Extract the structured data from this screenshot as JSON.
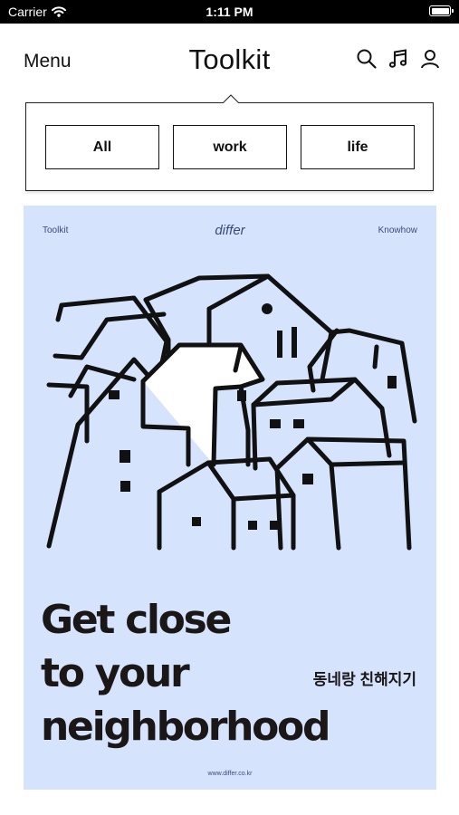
{
  "status_bar": {
    "carrier": "Carrier",
    "time": "1:11 PM"
  },
  "nav": {
    "menu_label": "Menu",
    "title": "Toolkit",
    "icons": [
      "search-icon",
      "music-icon",
      "profile-icon"
    ]
  },
  "filters": [
    {
      "label": "All"
    },
    {
      "label": "work"
    },
    {
      "label": "life"
    }
  ],
  "poster": {
    "label_left": "Toolkit",
    "brand": "differ",
    "label_right": "Knowhow",
    "headline": [
      "Get close",
      "to your",
      "neighborhood"
    ],
    "korean_text": "동네랑 친해지기",
    "site": "www.differ.co.kr",
    "background_color": "#d6e3fd",
    "ink_color": "#1b1717"
  }
}
